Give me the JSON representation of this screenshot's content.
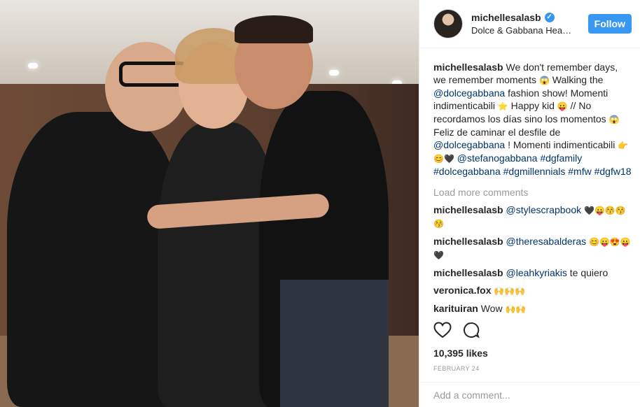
{
  "header": {
    "username": "michellesalasb",
    "location": "Dolce & Gabbana Hea…",
    "follow_label": "Follow"
  },
  "caption": {
    "username": "michellesalasb",
    "text_1": "We don't remember days, we remember moments",
    "text_2": "Walking the",
    "mention_1": "@dolcegabbana",
    "text_3": "fashion show! Momenti indimenticabili",
    "text_4": "Happy kid",
    "text_5": "// No recordamos los días sino los momentos",
    "text_6": "Feliz de caminar el desfile de",
    "mention_2": "@dolcegabbana",
    "text_7": "! Momenti indimenticabili",
    "mention_3": "@stefanogabbana",
    "hashtags": "#dgfamily #dolcegabbana #dgmillennials #mfw #dgfw18",
    "emoji_1": "😱",
    "emoji_2": "⭐",
    "emoji_3": "😛",
    "emoji_4": "😱",
    "emoji_5": "👉😊🖤"
  },
  "load_more": "Load more comments",
  "comments": [
    {
      "user": "michellesalasb",
      "mention": "@stylescrapbook",
      "text": "",
      "emoji": "🖤😛😚😚 😚"
    },
    {
      "user": "michellesalasb",
      "mention": "@theresabalderas",
      "text": "",
      "emoji": "😊😛😍😛 🖤"
    },
    {
      "user": "michellesalasb",
      "mention": "@leahkyriakis",
      "text": "te quiero",
      "emoji": ""
    },
    {
      "user": "veronica.fox",
      "mention": "",
      "text": "",
      "emoji": "🙌🙌🙌"
    },
    {
      "user": "karituiran",
      "mention": "",
      "text": "Wow",
      "emoji": "🙌🙌"
    }
  ],
  "likes": "10,395 likes",
  "date": "FEBRUARY 24",
  "add_comment_placeholder": "Add a comment...",
  "icons": {
    "like": "heart-icon",
    "comment": "comment-icon",
    "verified": "verified-badge-icon"
  },
  "colors": {
    "accent": "#3897f0",
    "link": "#003569",
    "muted": "#999999"
  }
}
